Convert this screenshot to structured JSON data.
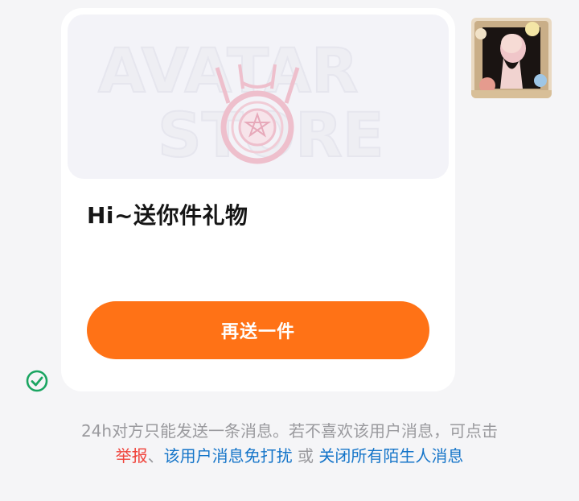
{
  "card": {
    "banner_text_top": "AVATAR",
    "banner_text_bottom": "STORE",
    "greeting": "Hi~送你件礼物",
    "send_again_label": "再送一件"
  },
  "icons": {
    "sent_status": "check-circle-icon",
    "avatar": "user-avatar"
  },
  "notice": {
    "text": "24h对方只能发送一条消息。若不喜欢该用户消息，可点击",
    "report_link": "举报",
    "separator": "、",
    "block_link": "该用户消息免打扰",
    "or": " 或 ",
    "close_all_link": "关闭所有陌生人消息"
  },
  "colors": {
    "accent": "#ff7216",
    "link_blue": "#1575c9",
    "link_red": "#f0433b",
    "check_green": "#1aa561"
  }
}
